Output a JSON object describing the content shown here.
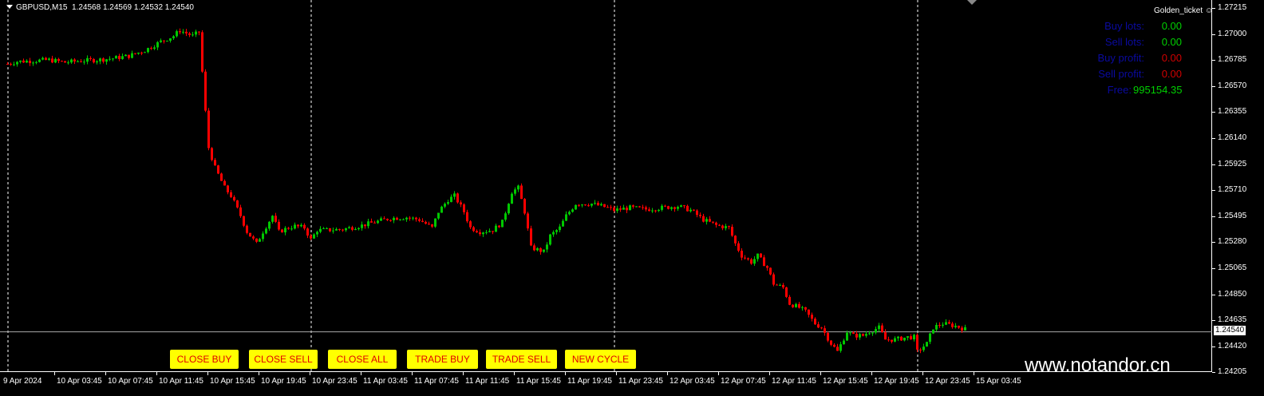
{
  "header": {
    "symbol": "GBPUSD,M15",
    "ohlc": "1.24568 1.24569 1.24532 1.24540"
  },
  "expert": {
    "name": "Golden_ticket",
    "icon": "smiley-icon"
  },
  "panel": {
    "buy_lots": {
      "label": "Buy lots:",
      "value": "0.00"
    },
    "sell_lots": {
      "label": "Sell lots:",
      "value": "0.00"
    },
    "buy_profit": {
      "label": "Buy profit:",
      "value": "0.00"
    },
    "sell_profit": {
      "label": "Sell profit:",
      "value": "0.00"
    },
    "free": {
      "label": "Free:",
      "value": "995154.35"
    }
  },
  "buttons": [
    "CLOSE BUY",
    "CLOSE SELL",
    "CLOSE ALL",
    "TRADE BUY",
    "TRADE SELL",
    "NEW CYCLE"
  ],
  "watermark": "www.notandor.cn",
  "colors": {
    "bull": "#00c800",
    "bear": "#ff0000",
    "label_blue": "#0a0aa0",
    "value_green": "#00d000",
    "value_red": "#d00000",
    "button": "#ffff00"
  },
  "chart_data": {
    "type": "candlestick",
    "current_price": "1.24540",
    "price_labels": [
      "1.27215",
      "1.27000",
      "1.26785",
      "1.26570",
      "1.26355",
      "1.26140",
      "1.25925",
      "1.25710",
      "1.25495",
      "1.25280",
      "1.25065",
      "1.24850",
      "1.24635",
      "1.24420",
      "1.24205"
    ],
    "ylim": [
      1.2416,
      1.2727
    ],
    "time_labels": [
      "9 Apr 2024",
      "10 Apr 03:45",
      "10 Apr 07:45",
      "10 Apr 11:45",
      "10 Apr 15:45",
      "10 Apr 19:45",
      "10 Apr 23:45",
      "11 Apr 03:45",
      "11 Apr 07:45",
      "11 Apr 11:45",
      "11 Apr 15:45",
      "11 Apr 19:45",
      "11 Apr 23:45",
      "12 Apr 03:45",
      "12 Apr 07:45",
      "12 Apr 11:45",
      "12 Apr 15:45",
      "12 Apr 19:45",
      "12 Apr 23:45",
      "15 Apr 03:45"
    ],
    "bars_per_label": 16,
    "day_separators_bar": [
      0,
      95,
      190,
      285
    ],
    "close_path": [
      [
        0,
        1.26753
      ],
      [
        3,
        1.26773
      ],
      [
        8,
        1.26779
      ],
      [
        13,
        1.26786
      ],
      [
        18,
        1.26766
      ],
      [
        23,
        1.26779
      ],
      [
        28,
        1.26786
      ],
      [
        33,
        1.26799
      ],
      [
        38,
        1.26819
      ],
      [
        43,
        1.26865
      ],
      [
        48,
        1.26938
      ],
      [
        52,
        1.26984
      ],
      [
        54,
        1.2703
      ],
      [
        58,
        1.26984
      ],
      [
        60,
        1.27017
      ],
      [
        62,
        1.26357
      ],
      [
        63,
        1.2606
      ],
      [
        65,
        1.25895
      ],
      [
        68,
        1.2573
      ],
      [
        70,
        1.25664
      ],
      [
        73,
        1.25499
      ],
      [
        75,
        1.25367
      ],
      [
        78,
        1.25268
      ],
      [
        80,
        1.25367
      ],
      [
        83,
        1.25499
      ],
      [
        85,
        1.25367
      ],
      [
        88,
        1.254
      ],
      [
        90,
        1.25413
      ],
      [
        93,
        1.254
      ],
      [
        95,
        1.25301
      ],
      [
        97,
        1.2538
      ],
      [
        100,
        1.2538
      ],
      [
        105,
        1.25387
      ],
      [
        110,
        1.25413
      ],
      [
        115,
        1.25446
      ],
      [
        120,
        1.25479
      ],
      [
        125,
        1.25486
      ],
      [
        129,
        1.25466
      ],
      [
        133,
        1.254
      ],
      [
        135,
        1.25532
      ],
      [
        138,
        1.25631
      ],
      [
        140,
        1.25664
      ],
      [
        143,
        1.25532
      ],
      [
        145,
        1.254
      ],
      [
        148,
        1.25367
      ],
      [
        152,
        1.2538
      ],
      [
        155,
        1.25446
      ],
      [
        158,
        1.25697
      ],
      [
        160,
        1.2573
      ],
      [
        162,
        1.25532
      ],
      [
        164,
        1.25235
      ],
      [
        168,
        1.25202
      ],
      [
        170,
        1.25334
      ],
      [
        173,
        1.254
      ],
      [
        175,
        1.25499
      ],
      [
        178,
        1.25598
      ],
      [
        183,
        1.25598
      ],
      [
        188,
        1.25565
      ],
      [
        190,
        1.25545
      ],
      [
        195,
        1.25565
      ],
      [
        200,
        1.25552
      ],
      [
        205,
        1.25565
      ],
      [
        210,
        1.25578
      ],
      [
        214,
        1.25545
      ],
      [
        218,
        1.25466
      ],
      [
        222,
        1.2542
      ],
      [
        226,
        1.254
      ],
      [
        228,
        1.25268
      ],
      [
        230,
        1.25169
      ],
      [
        233,
        1.25116
      ],
      [
        235,
        1.25169
      ],
      [
        238,
        1.2507
      ],
      [
        240,
        1.24938
      ],
      [
        243,
        1.24905
      ],
      [
        245,
        1.24773
      ],
      [
        248,
        1.2474
      ],
      [
        250,
        1.24707
      ],
      [
        253,
        1.24608
      ],
      [
        255,
        1.24575
      ],
      [
        258,
        1.24443
      ],
      [
        260,
        1.24377
      ],
      [
        263,
        1.24542
      ],
      [
        265,
        1.24509
      ],
      [
        268,
        1.24509
      ],
      [
        270,
        1.24542
      ],
      [
        273,
        1.24575
      ],
      [
        275,
        1.24476
      ],
      [
        278,
        1.24476
      ],
      [
        282,
        1.24496
      ],
      [
        284,
        1.24496
      ],
      [
        285,
        1.24377
      ],
      [
        288,
        1.24443
      ],
      [
        290,
        1.24575
      ],
      [
        293,
        1.24608
      ],
      [
        297,
        1.24588
      ],
      [
        300,
        1.24562
      ]
    ]
  }
}
